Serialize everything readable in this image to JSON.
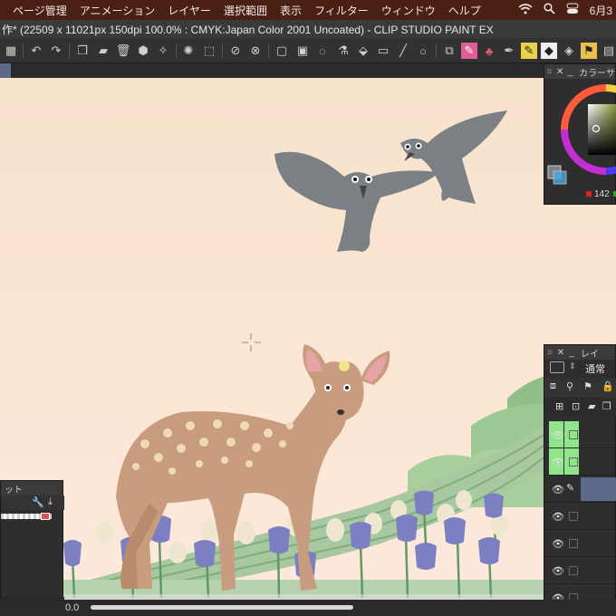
{
  "menubar": {
    "items": [
      "ページ管理",
      "アニメーション",
      "レイヤー",
      "選択範囲",
      "表示",
      "フィルター",
      "ウィンドウ",
      "ヘルプ"
    ],
    "date": "6月3"
  },
  "titlebar": {
    "title": "作* (22509 x 11021px 150dpi 100.0% : CMYK:Japan Color 2001 Uncoated)  - CLIP STUDIO PAINT EX"
  },
  "color_panel": {
    "title": "カラーサ",
    "value_label": "142"
  },
  "layer_panel": {
    "title": "レイ",
    "blend_mode": "通常"
  },
  "left_panel": {
    "title": "ット"
  },
  "status": {
    "zoom": "0.0"
  },
  "colors": {
    "menubar_bg": "#4a1f14",
    "canvas_top": "#f7e2cc",
    "canvas_bottom": "#fde9dc",
    "crow": "#7c7f84",
    "deer": "#c89c7e",
    "iris": "#7c7fc1",
    "hill_green": "#a7c8a0",
    "layer_active": "#8fe58a",
    "layer_selected": "#5a6a88"
  }
}
